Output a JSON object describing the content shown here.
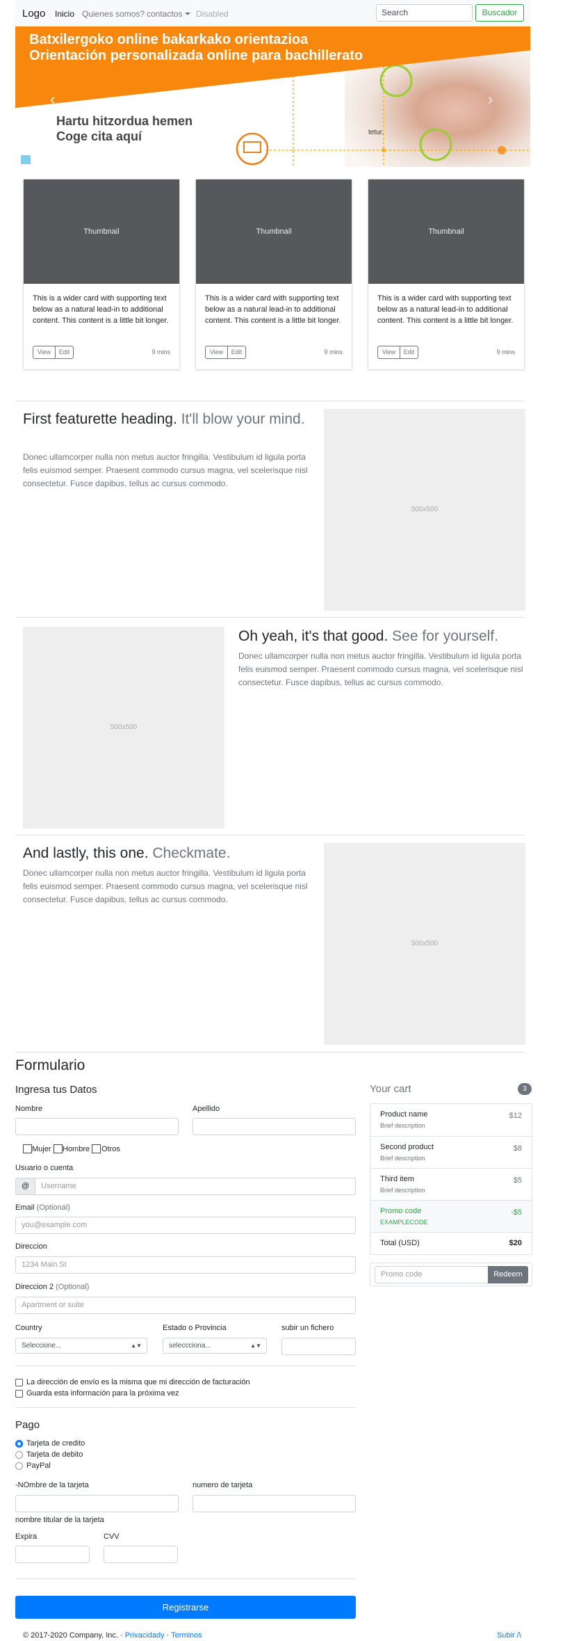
{
  "navbar": {
    "logo": "Logo",
    "links": [
      "Inicio",
      "Quienes somos?",
      "contactos",
      "Disabled"
    ],
    "search_placeholder": "Search",
    "search_button": "Buscador"
  },
  "banner": {
    "line1": "Batxilergoko online bakarkako orientazioa",
    "line2": "Orientación personalizada online para bachillerato",
    "line3": "Hartu hitzordua hemen",
    "line4": "Coge cita aquí",
    "overlay_text": "tetur."
  },
  "cards": [
    {
      "thumb": "Thumbnail",
      "text": "This is a wider card with supporting text below as a natural lead-in to additional content. This content is a little bit longer.",
      "view": "View",
      "edit": "Edit",
      "time": "9 mins"
    },
    {
      "thumb": "Thumbnail",
      "text": "This is a wider card with supporting text below as a natural lead-in to additional content. This content is a little bit longer.",
      "view": "View",
      "edit": "Edit",
      "time": "9 mins"
    },
    {
      "thumb": "Thumbnail",
      "text": "This is a wider card with supporting text below as a natural lead-in to additional content. This content is a little bit longer.",
      "view": "View",
      "edit": "Edit",
      "time": "9 mins"
    }
  ],
  "features": [
    {
      "heading": "First featurette heading.",
      "muted": "It'll blow your mind.",
      "text": "Donec ullamcorper nulla non metus auctor fringilla. Vestibulum id ligula porta felis euismod semper. Praesent commodo cursus magna, vel scelerisque nisl consectetur. Fusce dapibus, tellus ac cursus commodo.",
      "image": "500x500"
    },
    {
      "heading": "Oh yeah, it's that good.",
      "muted": "See for yourself.",
      "text": "Donec ullamcorper nulla non metus auctor fringilla. Vestibulum id ligula porta felis euismod semper. Praesent commodo cursus magna, vel scelerisque nisl consectetur. Fusce dapibus, tellus ac cursus commodo.",
      "image": "500x500"
    },
    {
      "heading": "And lastly, this one.",
      "muted": "Checkmate.",
      "text": "Donec ullamcorper nulla non metus auctor fringilla. Vestibulum id ligula porta felis euismod semper. Praesent commodo cursus magna, vel scelerisque nisl consectetur. Fusce dapibus, tellus ac cursus commodo.",
      "image": "500x500"
    }
  ],
  "form": {
    "title": "Formulario",
    "subtitle": "Ingresa tus Datos",
    "nombre": "Nombre",
    "apellido": "Apellido",
    "gender": [
      "Mujer",
      "Hombre",
      "Otros"
    ],
    "usuario": "Usuario o cuenta",
    "at": "@",
    "username_ph": "Username",
    "email": "Email",
    "optional": "(Optional)",
    "email_ph": "you@example.com",
    "direccion": "Direccion",
    "direccion_ph": "1234 Main St",
    "direccion2": "Direccion 2",
    "direccion2_ph": "Apartment or suite",
    "country": "Country",
    "country_sel": "Seleccione...",
    "estado": "Estado o Provincia",
    "estado_sel": "seleccciona...",
    "fichero": "subir un fichero",
    "check1": "La dirección de envío es la misma que mi dirección de facturación",
    "check2": "Guarda esta información para la próxima vez",
    "pago": "Pago",
    "payment": [
      "Tarjeta de credito",
      "Tarjeta de debito",
      "PayPal"
    ],
    "nombre_tarjeta": "-NOmbre de la tarjeta",
    "numero_tarjeta": "numero de tarjeta",
    "titular": "nombre titular de la tarjeta",
    "expira": "Expira",
    "cvv": "CVV",
    "submit": "Registrarse"
  },
  "cart": {
    "title": "Your cart",
    "count": "3",
    "items": [
      {
        "name": "Product name",
        "desc": "Brief description",
        "price": "$12"
      },
      {
        "name": "Second product",
        "desc": "Brief description",
        "price": "$8"
      },
      {
        "name": "Third item",
        "desc": "Brief description",
        "price": "$5"
      }
    ],
    "promo_name": "Promo code",
    "promo_code": "EXAMPLECODE",
    "promo_price": "-$5",
    "total_label": "Total (USD)",
    "total": "$20",
    "promo_ph": "Promo code",
    "redeem": "Redeem",
    "colors": {
      "success": "#28a745",
      "muted": "#6c757d"
    }
  },
  "footer": {
    "copyright": "© 2017-2020 Company, Inc. ·",
    "privacy": "Privacidady",
    "sep": "·",
    "terms": "Terminos",
    "up": "Subir /\\"
  },
  "colors": {
    "primary": "#007bff",
    "orange": "#f7870d",
    "success": "#28a745"
  }
}
